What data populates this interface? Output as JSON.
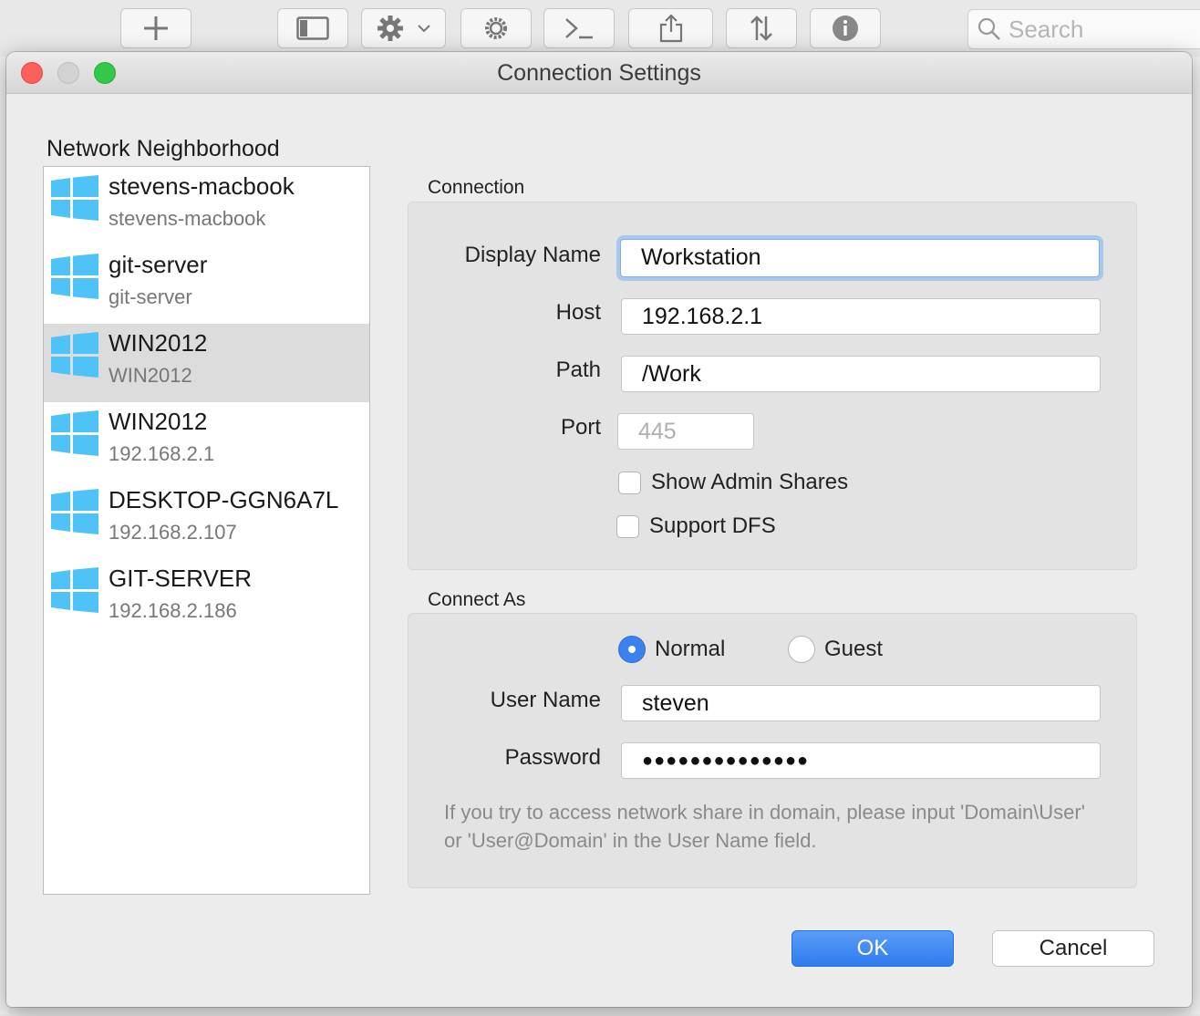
{
  "app": {
    "toolbar": {
      "search_placeholder": "Search"
    }
  },
  "dialog": {
    "title": "Connection Settings",
    "network_neighborhood": {
      "label": "Network Neighborhood",
      "items": [
        {
          "name": "stevens-macbook",
          "sub": "stevens-macbook",
          "selected": false
        },
        {
          "name": "git-server",
          "sub": "git-server",
          "selected": false
        },
        {
          "name": "WIN2012",
          "sub": "WIN2012",
          "selected": true
        },
        {
          "name": "WIN2012",
          "sub": "192.168.2.1",
          "selected": false
        },
        {
          "name": "DESKTOP-GGN6A7L",
          "sub": "192.168.2.107",
          "selected": false
        },
        {
          "name": "GIT-SERVER",
          "sub": "192.168.2.186",
          "selected": false
        }
      ]
    },
    "connection": {
      "label": "Connection",
      "display_name_label": "Display Name",
      "display_name_value": "Workstation",
      "host_label": "Host",
      "host_value": "192.168.2.1",
      "path_label": "Path",
      "path_value": "/Work",
      "port_label": "Port",
      "port_placeholder": "445",
      "show_admin_shares_label": "Show Admin Shares",
      "show_admin_shares_checked": false,
      "support_dfs_label": "Support DFS",
      "support_dfs_checked": false
    },
    "connect_as": {
      "label": "Connect As",
      "normal_label": "Normal",
      "guest_label": "Guest",
      "selected": "Normal",
      "user_name_label": "User Name",
      "user_name_value": "steven",
      "password_label": "Password",
      "password_value": "●●●●●●●●●●●●●●",
      "hint": "If you try to access network share in domain, please input 'Domain\\User' or 'User@Domain' in the User Name field."
    },
    "buttons": {
      "ok": "OK",
      "cancel": "Cancel"
    },
    "colors": {
      "accent": "#3b82f0",
      "windows_logo": "#4fc3f7",
      "close": "#fc605c",
      "maximize": "#34c84a"
    }
  }
}
